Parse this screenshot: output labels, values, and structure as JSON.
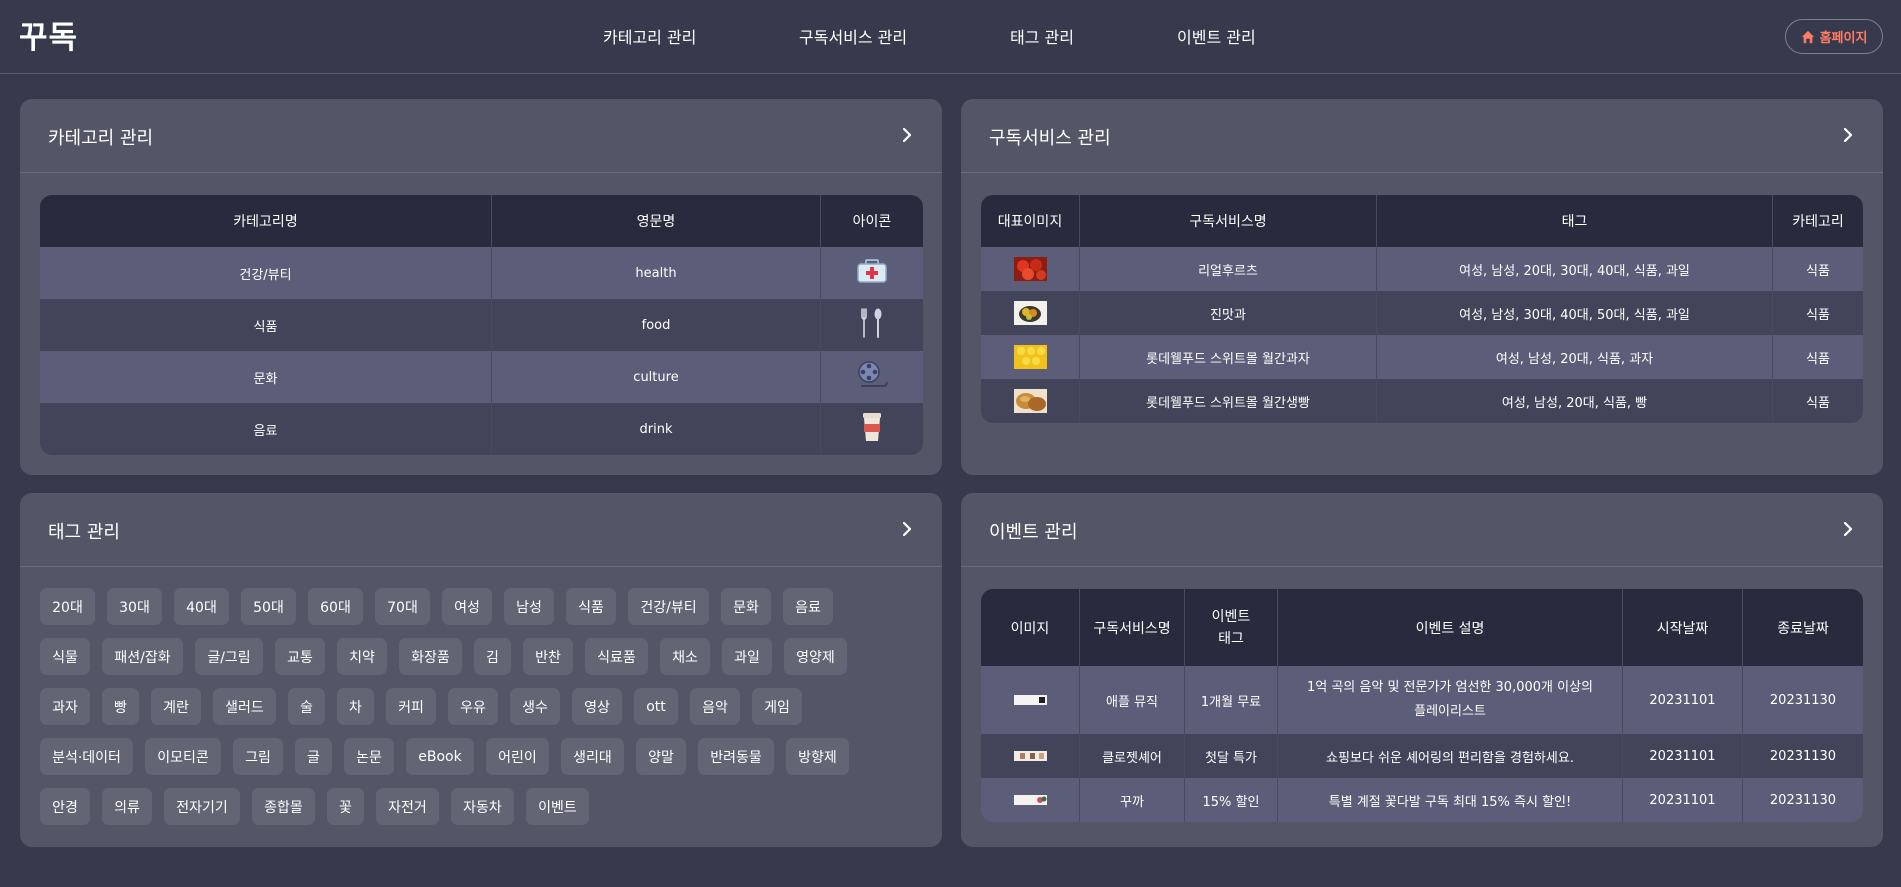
{
  "header": {
    "logo": "꾸독",
    "nav": [
      "카테고리 관리",
      "구독서비스 관리",
      "태그 관리",
      "이벤트 관리"
    ],
    "home_label": "홈페이지",
    "home_color": "#ff7b63"
  },
  "category_panel": {
    "title": "카테고리 관리",
    "columns": [
      "카테고리명",
      "영문명",
      "아이콘"
    ],
    "rows": [
      {
        "name": "건강/뷰티",
        "en": "health",
        "icon": "first-aid-kit-icon"
      },
      {
        "name": "식품",
        "en": "food",
        "icon": "fork-spoon-icon"
      },
      {
        "name": "문화",
        "en": "culture",
        "icon": "film-reel-icon"
      },
      {
        "name": "음료",
        "en": "drink",
        "icon": "coffee-cup-icon"
      }
    ]
  },
  "subscription_panel": {
    "title": "구독서비스 관리",
    "columns": [
      "대표이미지",
      "구독서비스명",
      "태그",
      "카테고리"
    ],
    "rows": [
      {
        "image": "tomato-thumbnail",
        "name": "리얼후르츠",
        "tags": "여성, 남성, 20대, 30대, 40대, 식품, 과일",
        "category": "식품"
      },
      {
        "image": "fruit-bowl-thumbnail",
        "name": "진맛과",
        "tags": "여성, 남성, 30대, 40대, 50대, 식품, 과일",
        "category": "식품"
      },
      {
        "image": "snack-thumbnail",
        "name": "롯데웰푸드 스위트몰 월간과자",
        "tags": "여성, 남성, 20대, 식품, 과자",
        "category": "식품"
      },
      {
        "image": "bread-thumbnail",
        "name": "롯데웰푸드 스위트몰 월간생빵",
        "tags": "여성, 남성, 20대, 식품, 빵",
        "category": "식품"
      }
    ]
  },
  "tag_panel": {
    "title": "태그 관리",
    "tags": [
      "20대",
      "30대",
      "40대",
      "50대",
      "60대",
      "70대",
      "여성",
      "남성",
      "식품",
      "건강/뷰티",
      "문화",
      "음료",
      "식물",
      "패션/잡화",
      "글/그림",
      "교통",
      "치약",
      "화장품",
      "김",
      "반찬",
      "식료품",
      "채소",
      "과일",
      "영양제",
      "과자",
      "빵",
      "계란",
      "샐러드",
      "술",
      "차",
      "커피",
      "우유",
      "생수",
      "영상",
      "ott",
      "음악",
      "게임",
      "분석·데이터",
      "이모티콘",
      "그림",
      "글",
      "논문",
      "eBook",
      "어린이",
      "생리대",
      "양말",
      "반려동물",
      "방향제",
      "안경",
      "의류",
      "전자기기",
      "종합몰",
      "꽃",
      "자전거",
      "자동차",
      "이벤트"
    ]
  },
  "event_panel": {
    "title": "이벤트 관리",
    "columns": [
      "이미지",
      "구독서비스명",
      "이벤트\n태그",
      "이벤트 설명",
      "시작날짜",
      "종료날짜"
    ],
    "rows": [
      {
        "image": "apple-music-banner",
        "service": "애플 뮤직",
        "tag": "1개월 무료",
        "desc": "1억 곡의 음악 및 전문가가 엄선한 30,000개 이상의\n플레이리스트",
        "start": "20231101",
        "end": "20231130"
      },
      {
        "image": "closet-share-banner",
        "service": "클로젯셰어",
        "tag": "첫달 특가",
        "desc": "쇼핑보다 쉬운 셰어링의 편리함을 경험하세요.",
        "start": "20231101",
        "end": "20231130"
      },
      {
        "image": "kkukka-banner",
        "service": "꾸까",
        "tag": "15% 할인",
        "desc": "특별 계절 꽃다발 구독 최대 15% 즉시 할인!",
        "start": "20231101",
        "end": "20231130"
      }
    ]
  }
}
